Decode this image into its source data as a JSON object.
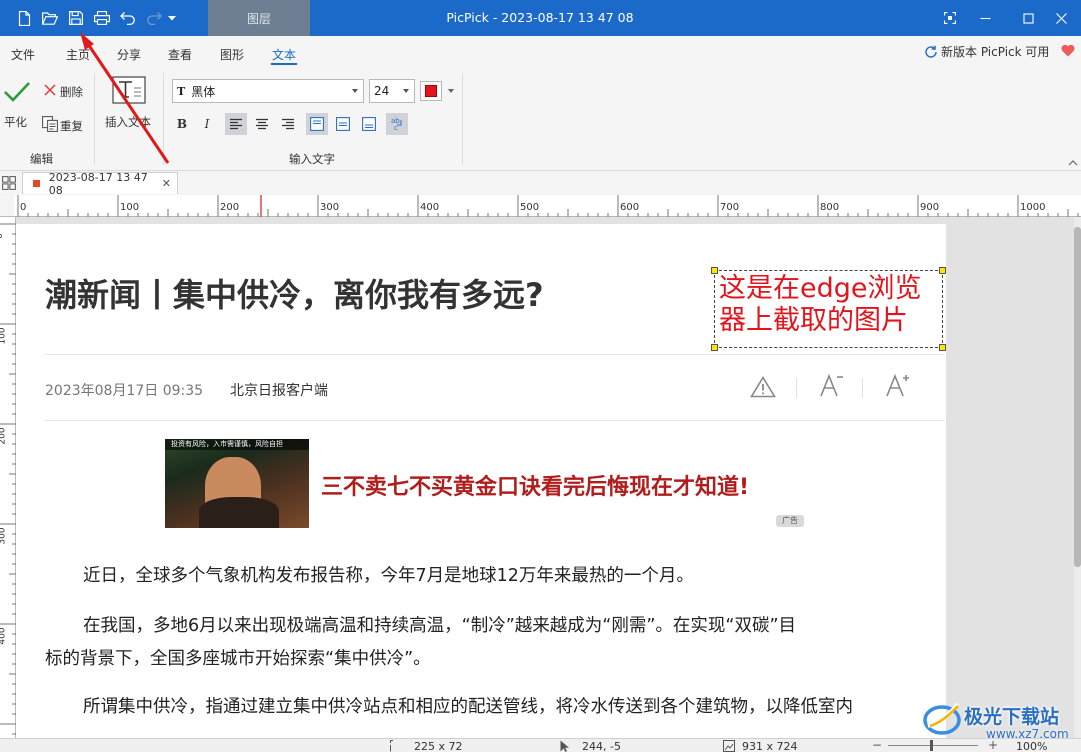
{
  "window": {
    "active_tab": "图层",
    "title": "PicPick - 2023-08-17 13 47 08"
  },
  "menu": {
    "items": [
      "文件",
      "主页",
      "分享",
      "查看",
      "图形",
      "文本"
    ],
    "active": "文本",
    "update_notice": "新版本 PicPick 可用"
  },
  "ribbon": {
    "edit_group": {
      "label": "编辑",
      "flatten": "平化",
      "delete": "删除",
      "duplicate": "重复"
    },
    "insert_text": "插入文本",
    "text_group_label": "输入文字",
    "font_name": "黑体",
    "font_size": "24",
    "font_color": "#e2141c"
  },
  "document_tab": {
    "name": "2023-08-17 13 47 08"
  },
  "ruler": {
    "horizontal_ticks": [
      "0",
      "100",
      "200",
      "300",
      "400",
      "500",
      "600",
      "700",
      "800",
      "900",
      "1000"
    ],
    "vertical_ticks": [
      "0",
      "100",
      "200",
      "300",
      "400"
    ]
  },
  "canvas": {
    "headline": "潮新闻丨集中供冷，离你我有多远?",
    "annotation": [
      "这是在edge浏览",
      "器上截取的图片"
    ],
    "meta_date": "2023年08月17日 09:35",
    "meta_source": "北京日报客户端",
    "ad_image_caption": "投资有风险，入市需谨慎，风险自担",
    "ad_text": "三不卖七不买黄金口诀看完后悔现在才知道!",
    "ad_badge": "广告",
    "paragraphs": [
      "近日，全球多个气象机构发布报告称，今年7月是地球12万年来最热的一个月。",
      "在我国，多地6月以来出现极端高温和持续高温，“制冷”越来越成为“刚需”。在实现“双碳”目",
      "标的背景下，全国多座城市开始探索“集中供冷”。",
      "所谓集中供冷，指通过建立集中供冷站点和相应的配送管线，将冷水传送到各个建筑物，以降低室内"
    ]
  },
  "status": {
    "selection_size": "225 x 72",
    "cursor_pos": "244, -5",
    "image_size": "931 x 724",
    "zoom": "100%"
  },
  "watermark": {
    "name": "极光下载站",
    "url": "www.xz7.com"
  }
}
